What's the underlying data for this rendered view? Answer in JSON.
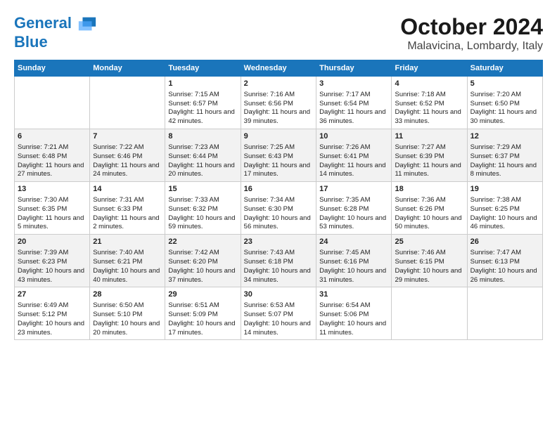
{
  "header": {
    "logo_line1": "General",
    "logo_line2": "Blue",
    "month": "October 2024",
    "location": "Malavicina, Lombardy, Italy"
  },
  "weekdays": [
    "Sunday",
    "Monday",
    "Tuesday",
    "Wednesday",
    "Thursday",
    "Friday",
    "Saturday"
  ],
  "weeks": [
    [
      {
        "day": "",
        "text": ""
      },
      {
        "day": "",
        "text": ""
      },
      {
        "day": "1",
        "text": "Sunrise: 7:15 AM\nSunset: 6:57 PM\nDaylight: 11 hours and 42 minutes."
      },
      {
        "day": "2",
        "text": "Sunrise: 7:16 AM\nSunset: 6:56 PM\nDaylight: 11 hours and 39 minutes."
      },
      {
        "day": "3",
        "text": "Sunrise: 7:17 AM\nSunset: 6:54 PM\nDaylight: 11 hours and 36 minutes."
      },
      {
        "day": "4",
        "text": "Sunrise: 7:18 AM\nSunset: 6:52 PM\nDaylight: 11 hours and 33 minutes."
      },
      {
        "day": "5",
        "text": "Sunrise: 7:20 AM\nSunset: 6:50 PM\nDaylight: 11 hours and 30 minutes."
      }
    ],
    [
      {
        "day": "6",
        "text": "Sunrise: 7:21 AM\nSunset: 6:48 PM\nDaylight: 11 hours and 27 minutes."
      },
      {
        "day": "7",
        "text": "Sunrise: 7:22 AM\nSunset: 6:46 PM\nDaylight: 11 hours and 24 minutes."
      },
      {
        "day": "8",
        "text": "Sunrise: 7:23 AM\nSunset: 6:44 PM\nDaylight: 11 hours and 20 minutes."
      },
      {
        "day": "9",
        "text": "Sunrise: 7:25 AM\nSunset: 6:43 PM\nDaylight: 11 hours and 17 minutes."
      },
      {
        "day": "10",
        "text": "Sunrise: 7:26 AM\nSunset: 6:41 PM\nDaylight: 11 hours and 14 minutes."
      },
      {
        "day": "11",
        "text": "Sunrise: 7:27 AM\nSunset: 6:39 PM\nDaylight: 11 hours and 11 minutes."
      },
      {
        "day": "12",
        "text": "Sunrise: 7:29 AM\nSunset: 6:37 PM\nDaylight: 11 hours and 8 minutes."
      }
    ],
    [
      {
        "day": "13",
        "text": "Sunrise: 7:30 AM\nSunset: 6:35 PM\nDaylight: 11 hours and 5 minutes."
      },
      {
        "day": "14",
        "text": "Sunrise: 7:31 AM\nSunset: 6:33 PM\nDaylight: 11 hours and 2 minutes."
      },
      {
        "day": "15",
        "text": "Sunrise: 7:33 AM\nSunset: 6:32 PM\nDaylight: 10 hours and 59 minutes."
      },
      {
        "day": "16",
        "text": "Sunrise: 7:34 AM\nSunset: 6:30 PM\nDaylight: 10 hours and 56 minutes."
      },
      {
        "day": "17",
        "text": "Sunrise: 7:35 AM\nSunset: 6:28 PM\nDaylight: 10 hours and 53 minutes."
      },
      {
        "day": "18",
        "text": "Sunrise: 7:36 AM\nSunset: 6:26 PM\nDaylight: 10 hours and 50 minutes."
      },
      {
        "day": "19",
        "text": "Sunrise: 7:38 AM\nSunset: 6:25 PM\nDaylight: 10 hours and 46 minutes."
      }
    ],
    [
      {
        "day": "20",
        "text": "Sunrise: 7:39 AM\nSunset: 6:23 PM\nDaylight: 10 hours and 43 minutes."
      },
      {
        "day": "21",
        "text": "Sunrise: 7:40 AM\nSunset: 6:21 PM\nDaylight: 10 hours and 40 minutes."
      },
      {
        "day": "22",
        "text": "Sunrise: 7:42 AM\nSunset: 6:20 PM\nDaylight: 10 hours and 37 minutes."
      },
      {
        "day": "23",
        "text": "Sunrise: 7:43 AM\nSunset: 6:18 PM\nDaylight: 10 hours and 34 minutes."
      },
      {
        "day": "24",
        "text": "Sunrise: 7:45 AM\nSunset: 6:16 PM\nDaylight: 10 hours and 31 minutes."
      },
      {
        "day": "25",
        "text": "Sunrise: 7:46 AM\nSunset: 6:15 PM\nDaylight: 10 hours and 29 minutes."
      },
      {
        "day": "26",
        "text": "Sunrise: 7:47 AM\nSunset: 6:13 PM\nDaylight: 10 hours and 26 minutes."
      }
    ],
    [
      {
        "day": "27",
        "text": "Sunrise: 6:49 AM\nSunset: 5:12 PM\nDaylight: 10 hours and 23 minutes."
      },
      {
        "day": "28",
        "text": "Sunrise: 6:50 AM\nSunset: 5:10 PM\nDaylight: 10 hours and 20 minutes."
      },
      {
        "day": "29",
        "text": "Sunrise: 6:51 AM\nSunset: 5:09 PM\nDaylight: 10 hours and 17 minutes."
      },
      {
        "day": "30",
        "text": "Sunrise: 6:53 AM\nSunset: 5:07 PM\nDaylight: 10 hours and 14 minutes."
      },
      {
        "day": "31",
        "text": "Sunrise: 6:54 AM\nSunset: 5:06 PM\nDaylight: 10 hours and 11 minutes."
      },
      {
        "day": "",
        "text": ""
      },
      {
        "day": "",
        "text": ""
      }
    ]
  ]
}
